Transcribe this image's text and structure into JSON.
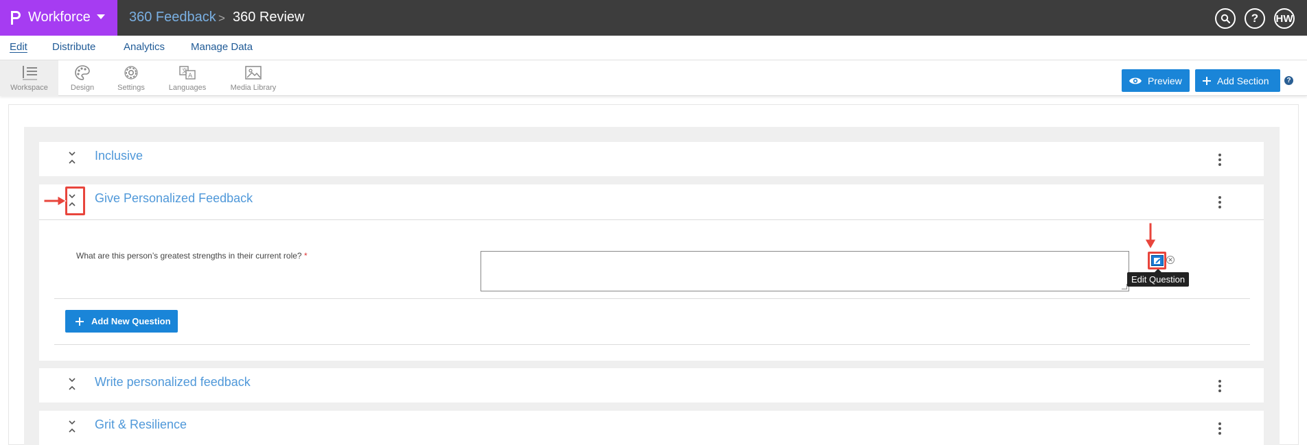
{
  "header": {
    "brand": "Workforce",
    "breadcrumb_parent": "360 Feedback",
    "breadcrumb_separator": ">",
    "breadcrumb_current": "360 Review",
    "avatar_initials": "HW",
    "help_glyph": "?"
  },
  "nav": {
    "edit": "Edit",
    "distribute": "Distribute",
    "analytics": "Analytics",
    "manage_data": "Manage Data"
  },
  "toolbar": {
    "workspace": "Workspace",
    "design": "Design",
    "settings": "Settings",
    "languages": "Languages",
    "media_library": "Media Library",
    "preview": "Preview",
    "add_section": "Add Section",
    "help_glyph": "?"
  },
  "sections": [
    {
      "title": "Inclusive",
      "expanded": false
    },
    {
      "title": "Give Personalized Feedback",
      "expanded": true
    },
    {
      "title": "Write personalized feedback",
      "expanded": false
    },
    {
      "title": "Grit & Resilience",
      "expanded": false
    }
  ],
  "question": {
    "text": "What are this person’s greatest strengths in their current role?",
    "required_marker": "*",
    "answer": "",
    "remove_glyph": "✕"
  },
  "tooltip": "Edit Question",
  "add_question_label": "Add New Question",
  "colors": {
    "topbar": "#3d3d3d",
    "brand": "#a63cf2",
    "primary_button": "#1a85d8",
    "section_title": "#4f98d9",
    "annotation": "#e8453c"
  }
}
